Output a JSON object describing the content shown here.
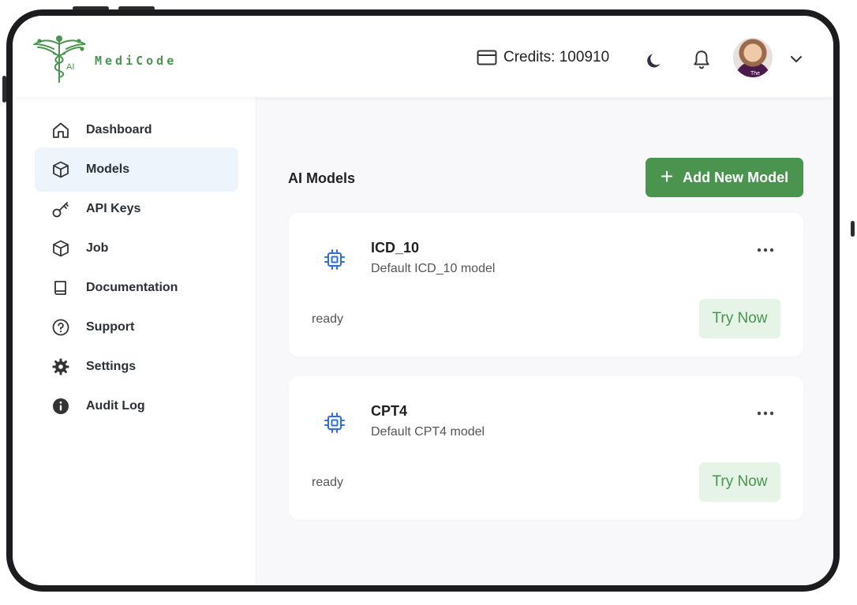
{
  "brand": {
    "name": "MediCode",
    "logo_badge": "AI",
    "accent": "#4a9450"
  },
  "header": {
    "credits_label": "Credits: 100910",
    "icons": [
      "credit-card-icon",
      "moon-icon",
      "bell-icon",
      "chevron-down-icon"
    ],
    "avatar_caption": "The"
  },
  "sidebar": {
    "items": [
      {
        "label": "Dashboard",
        "icon": "home-icon",
        "active": false
      },
      {
        "label": "Models",
        "icon": "cube-icon",
        "active": true
      },
      {
        "label": "API Keys",
        "icon": "key-icon",
        "active": false
      },
      {
        "label": "Job",
        "icon": "cube-icon",
        "active": false
      },
      {
        "label": "Documentation",
        "icon": "book-icon",
        "active": false
      },
      {
        "label": "Support",
        "icon": "help-circle-icon",
        "active": false
      },
      {
        "label": "Settings",
        "icon": "gear-icon",
        "active": false
      },
      {
        "label": "Audit Log",
        "icon": "info-icon",
        "active": false
      }
    ]
  },
  "main": {
    "title": "AI Models",
    "add_button": {
      "label": "Add New Model",
      "icon": "plus-icon"
    },
    "models": [
      {
        "name": "ICD_10",
        "description": "Default ICD_10 model",
        "status": "ready",
        "action": "Try Now"
      },
      {
        "name": "CPT4",
        "description": "Default CPT4 model",
        "status": "ready",
        "action": "Try Now"
      }
    ]
  }
}
